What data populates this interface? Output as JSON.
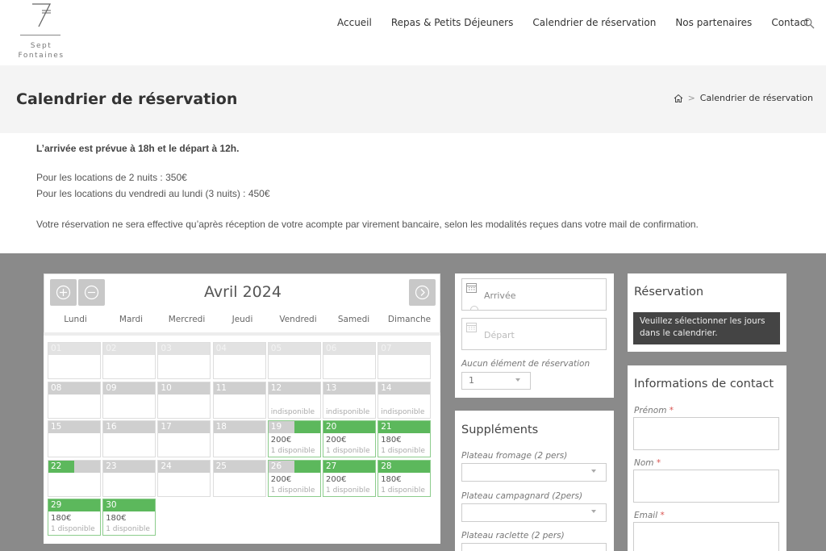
{
  "brand": {
    "line1": "Sept",
    "line2": "Fontaines"
  },
  "nav": {
    "items": [
      "Accueil",
      "Repas & Petits Déjeuners",
      "Calendrier de réservation",
      "Nos partenaires",
      "Contact"
    ]
  },
  "banner": {
    "title": "Calendrier de réservation",
    "breadcrumb_current": "Calendrier de réservation",
    "breadcrumb_sep": ">"
  },
  "info": {
    "arrival": "L’arrivée est prévue à 18h et le départ à 12h.",
    "price1": "Pour les locations de 2 nuits :  350€",
    "price2": "Pour les locations du vendredi au lundi (3 nuits) : 450€",
    "note": "Votre réservation ne sera effective qu’après réception de votre acompte par virement bancaire, selon les modalités reçues dans votre mail de confirmation."
  },
  "calendar": {
    "month": "Avril 2024",
    "weekdays": [
      "Lundi",
      "Mardi",
      "Mercredi",
      "Jeudi",
      "Vendredi",
      "Samedi",
      "Dimanche"
    ],
    "days": [
      {
        "n": "01",
        "s": "faded"
      },
      {
        "n": "02",
        "s": "faded"
      },
      {
        "n": "03",
        "s": "faded"
      },
      {
        "n": "04",
        "s": "faded"
      },
      {
        "n": "05",
        "s": "faded"
      },
      {
        "n": "06",
        "s": "faded"
      },
      {
        "n": "07",
        "s": "faded"
      },
      {
        "n": "08",
        "s": "off"
      },
      {
        "n": "09",
        "s": "off"
      },
      {
        "n": "10",
        "s": "off"
      },
      {
        "n": "11",
        "s": "off"
      },
      {
        "n": "12",
        "s": "off",
        "note": "indisponible"
      },
      {
        "n": "13",
        "s": "off",
        "note": "indisponible"
      },
      {
        "n": "14",
        "s": "off",
        "note": "indisponible"
      },
      {
        "n": "15",
        "s": "off"
      },
      {
        "n": "16",
        "s": "off"
      },
      {
        "n": "17",
        "s": "off"
      },
      {
        "n": "18",
        "s": "off"
      },
      {
        "n": "19",
        "s": "half",
        "price": "200€",
        "note": "1 disponible"
      },
      {
        "n": "20",
        "s": "avail",
        "price": "200€",
        "note": "1 disponible"
      },
      {
        "n": "21",
        "s": "avail",
        "price": "180€",
        "note": "1 disponible"
      },
      {
        "n": "22",
        "s": "halfl"
      },
      {
        "n": "23",
        "s": "off"
      },
      {
        "n": "24",
        "s": "off"
      },
      {
        "n": "25",
        "s": "off"
      },
      {
        "n": "26",
        "s": "half",
        "price": "200€",
        "note": "1 disponible"
      },
      {
        "n": "27",
        "s": "avail",
        "price": "200€",
        "note": "1 disponible"
      },
      {
        "n": "28",
        "s": "avail",
        "price": "180€",
        "note": "1 disponible"
      },
      {
        "n": "29",
        "s": "avail",
        "price": "180€",
        "note": "1 disponible"
      },
      {
        "n": "30",
        "s": "avail",
        "price": "180€",
        "note": "1 disponible"
      }
    ]
  },
  "booking": {
    "arrival_label": "Arrivée",
    "departure_label": "Départ",
    "none_label": "Aucun élément de réservation",
    "qty_value": "1"
  },
  "supplements": {
    "title": "Suppléments",
    "items": [
      "Plateau fromage (2 pers)",
      "Plateau campagnard (2pers)",
      "Plateau raclette (2 pers)"
    ]
  },
  "reservation": {
    "title": "Réservation",
    "message": "Veuillez sélectionner les jours dans le calendrier."
  },
  "contact": {
    "title": "Informations de contact",
    "fields": [
      "Prénom",
      "Nom",
      "Email"
    ],
    "required_mark": "*"
  },
  "colors": {
    "available": "#5cb85c",
    "unavailable": "#cfcfcf",
    "section_bg": "#8a8a8a"
  }
}
